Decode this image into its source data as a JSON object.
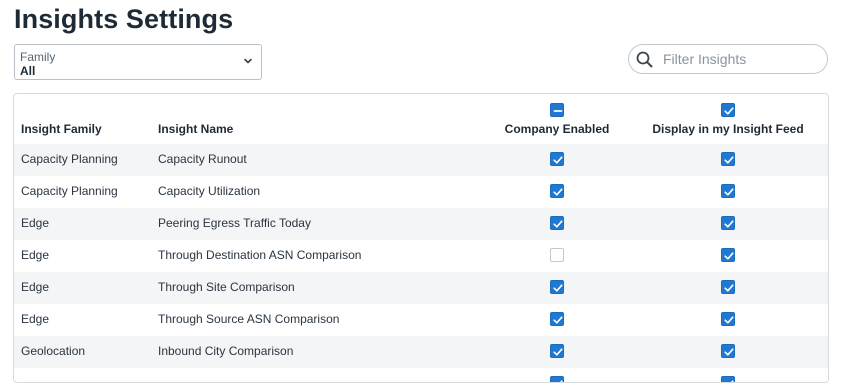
{
  "page": {
    "title": "Insights Settings"
  },
  "filter": {
    "label": "Family",
    "value": "All"
  },
  "search": {
    "placeholder": "Filter Insights"
  },
  "table": {
    "columns": {
      "family": "Insight Family",
      "name": "Insight Name",
      "company": "Company Enabled",
      "feed": "Display in my Insight Feed"
    },
    "header_checkboxes": {
      "company": "indeterminate",
      "feed": "checked"
    },
    "rows": [
      {
        "family": "Capacity Planning",
        "name": "Capacity Runout",
        "company": true,
        "feed": true
      },
      {
        "family": "Capacity Planning",
        "name": "Capacity Utilization",
        "company": true,
        "feed": true
      },
      {
        "family": "Edge",
        "name": "Peering Egress Traffic Today",
        "company": true,
        "feed": true
      },
      {
        "family": "Edge",
        "name": "Through Destination ASN Comparison",
        "company": false,
        "feed": true
      },
      {
        "family": "Edge",
        "name": "Through Site Comparison",
        "company": true,
        "feed": true
      },
      {
        "family": "Edge",
        "name": "Through Source ASN Comparison",
        "company": true,
        "feed": true
      },
      {
        "family": "Geolocation",
        "name": "Inbound City Comparison",
        "company": true,
        "feed": true
      },
      {
        "family": "",
        "name": "",
        "company": true,
        "feed": true
      }
    ]
  },
  "icons": {
    "search": "search-icon",
    "chevron": "chevron-down-icon",
    "check": "check-icon",
    "minus": "minus-icon"
  },
  "colors": {
    "accent": "#1f78d1",
    "text": "#1f2a37",
    "stripe": "#f4f5f6",
    "border": "#d6dbe0"
  }
}
